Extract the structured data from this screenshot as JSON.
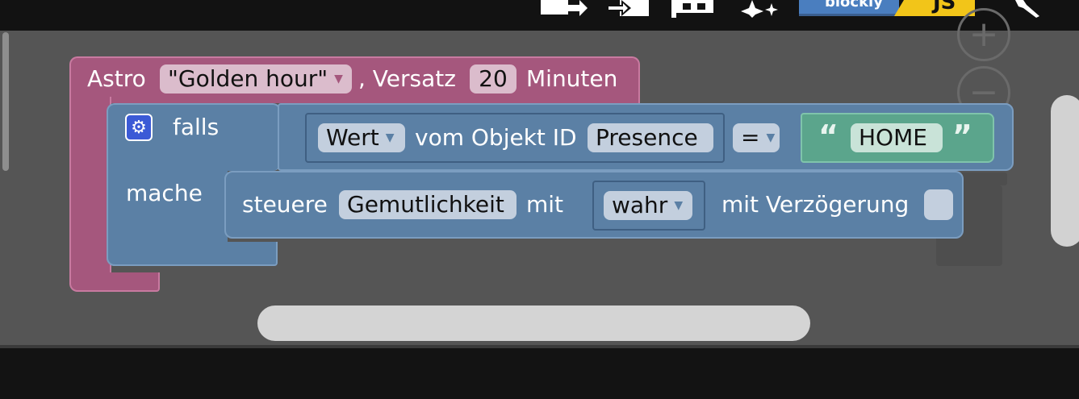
{
  "toolbar": {
    "icons": [
      "export-icon",
      "import-icon",
      "flag-icon",
      "sparkle-icon",
      "blockly-logo",
      "js-logo",
      "wrench-icon"
    ],
    "blockly_label": "blockly",
    "js_label": "JS"
  },
  "zoom": {
    "in_symbol": "+",
    "out_symbol": "−"
  },
  "astro_block": {
    "label": "Astro",
    "event_value": "\"Golden hour\"",
    "offset_label": ", Versatz",
    "offset_value": "20",
    "unit_label": "Minuten"
  },
  "if_block": {
    "label": "falls",
    "do_label": "mache",
    "gear_symbol": "⚙"
  },
  "compare_block": {
    "property_value": "Wert",
    "of_object_label": "vom Objekt ID",
    "object_id": "Presence",
    "operator": "=",
    "quote_open": "“",
    "text_value": "HOME",
    "quote_close": "”"
  },
  "control_block": {
    "label": "steuere",
    "object_name": "Gemutlichkeit",
    "with_label": "mit",
    "value": "wahr",
    "delay_label": "mit Verzögerung"
  },
  "colors": {
    "astro": "#a5577d",
    "logic": "#5b80a5",
    "text": "#5ba58c",
    "workspace": "#555555"
  }
}
